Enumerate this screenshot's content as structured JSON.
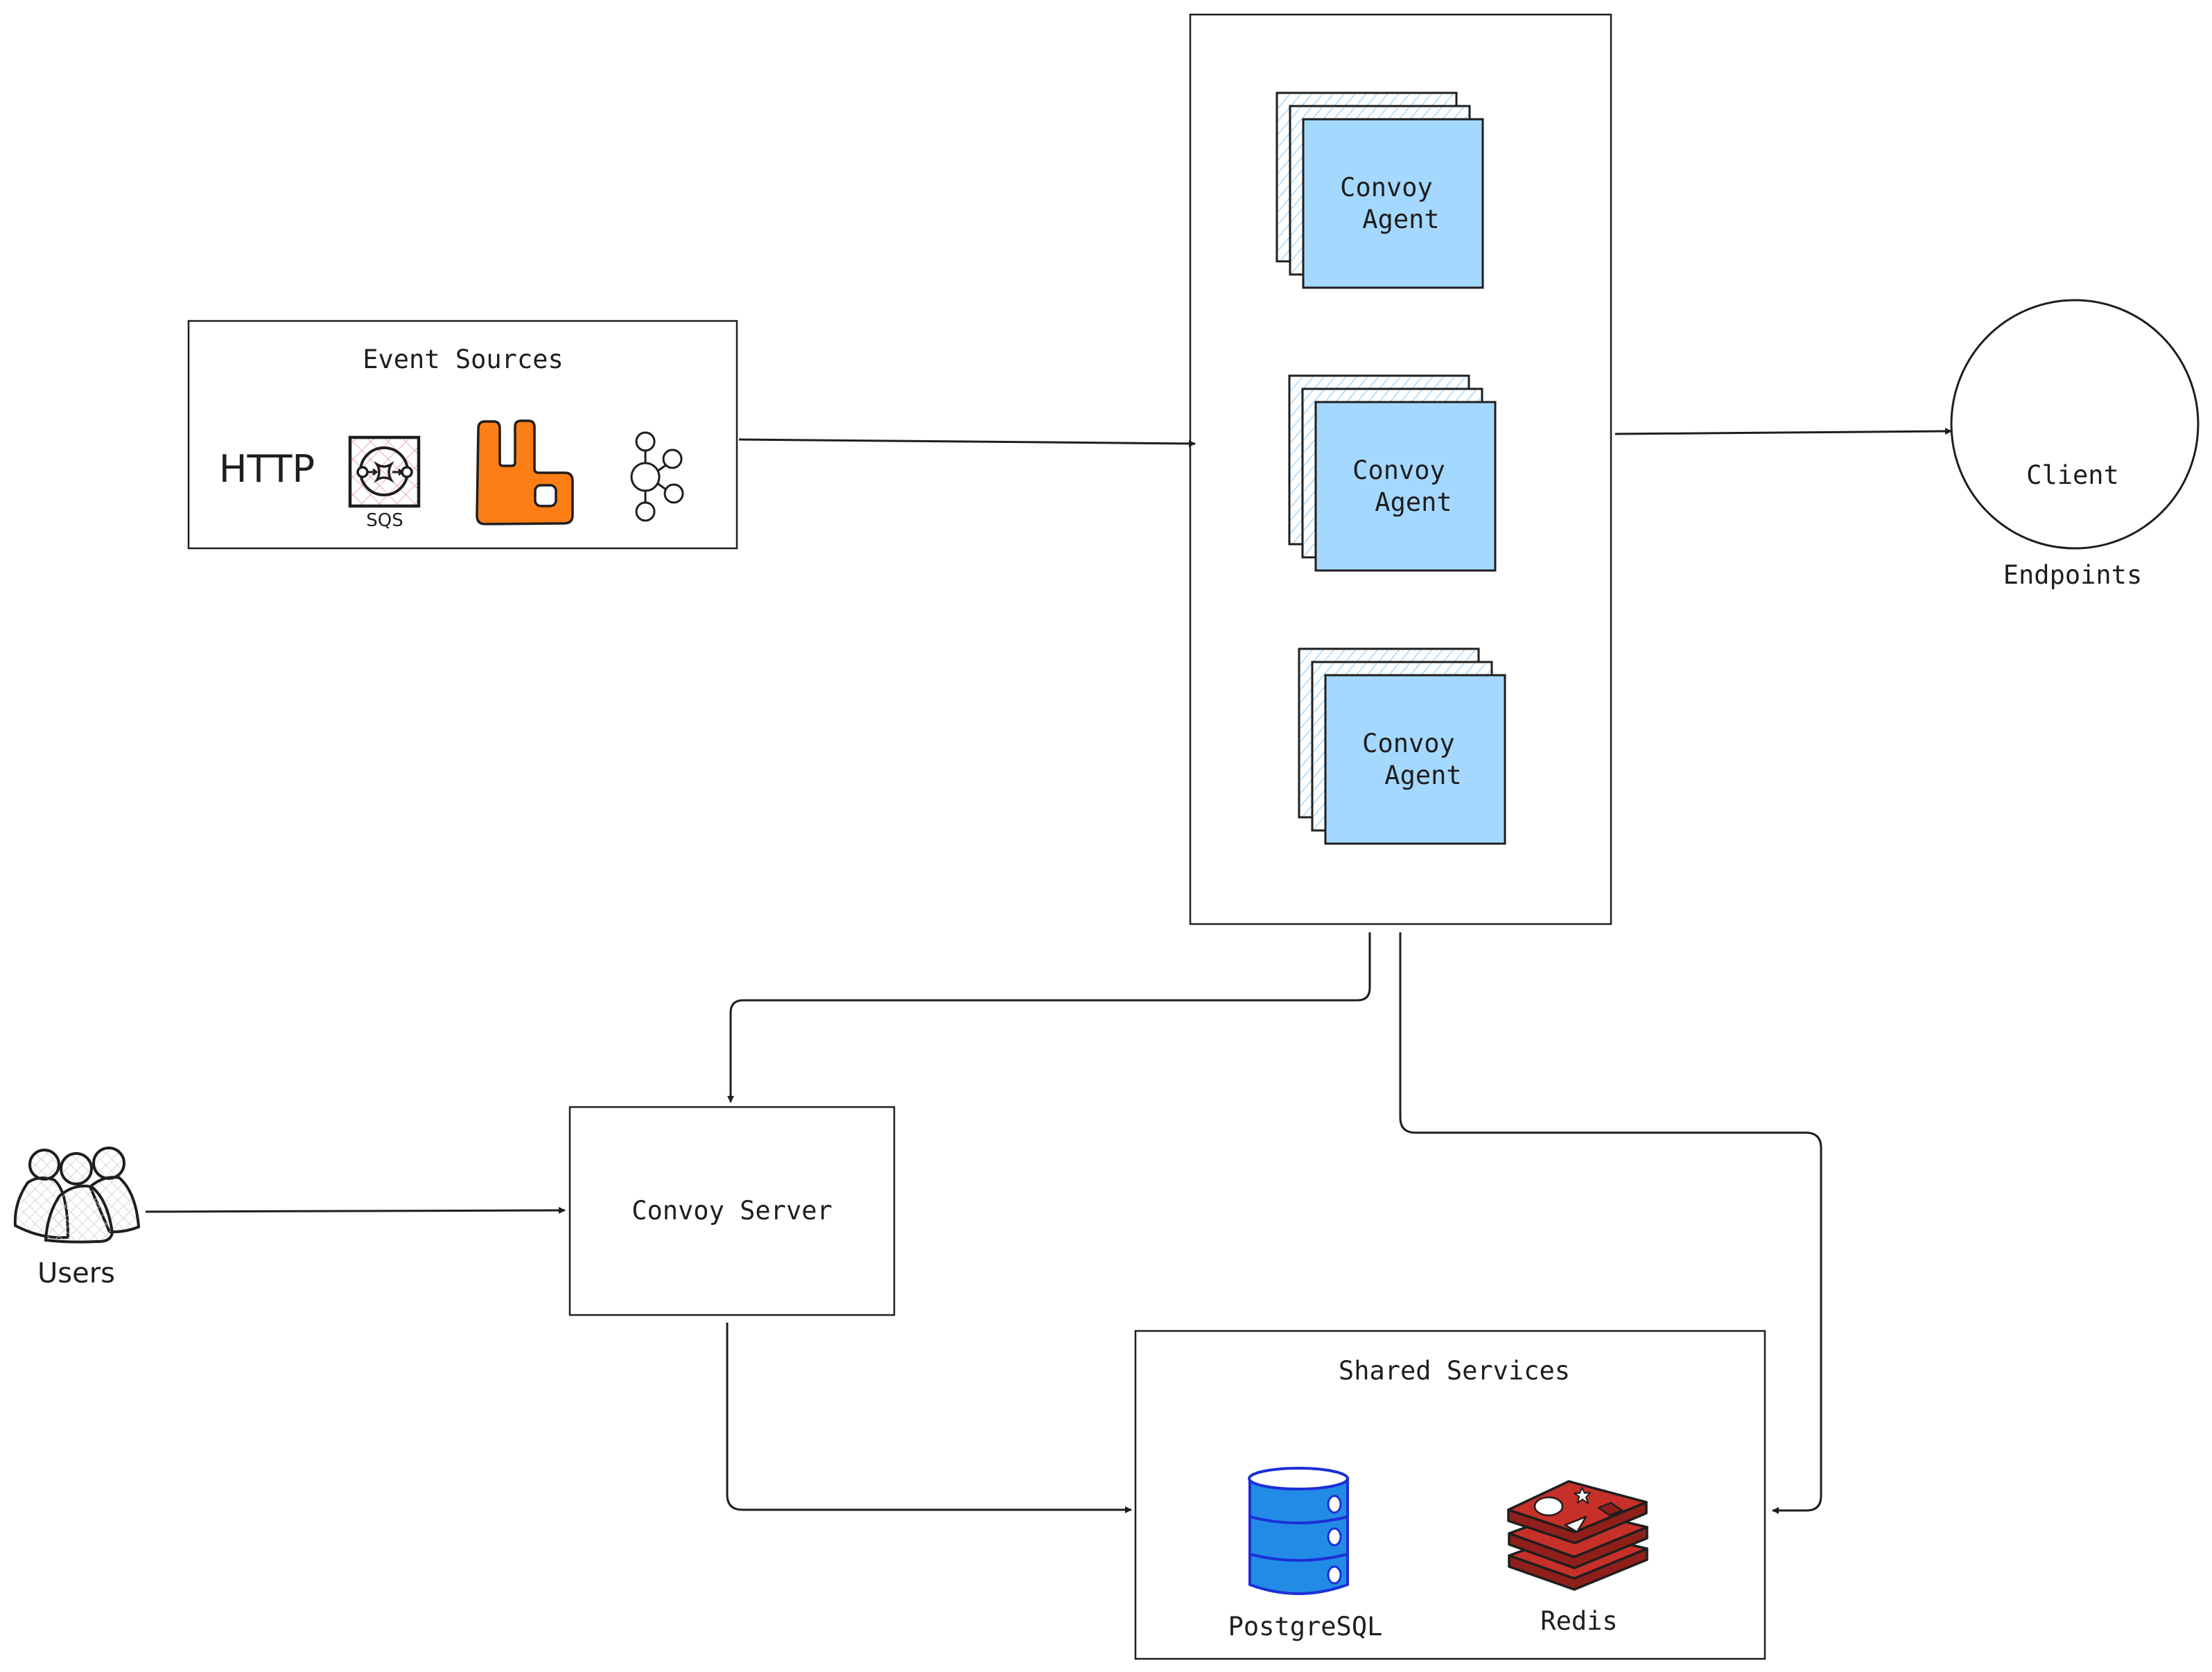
{
  "diagram": {
    "event_sources": {
      "title": "Event Sources",
      "items": [
        {
          "label": "HTTP",
          "icon": "http-text"
        },
        {
          "label": "SQS",
          "icon": "aws-sqs-icon"
        },
        {
          "label": "",
          "icon": "rabbitmq-icon"
        },
        {
          "label": "",
          "icon": "kafka-icon"
        }
      ]
    },
    "agents": [
      {
        "line1": "Convoy",
        "line2": "Agent"
      },
      {
        "line1": "Convoy",
        "line2": "Agent"
      },
      {
        "line1": "Convoy",
        "line2": "Agent"
      }
    ],
    "client_endpoints": {
      "line1": "Client",
      "line2": "Endpoints"
    },
    "users": {
      "label": "Users",
      "icon": "users-icon"
    },
    "convoy_server": {
      "label": "Convoy Server"
    },
    "shared_services": {
      "title": "Shared Services",
      "items": [
        {
          "label": "PostgreSQL",
          "icon": "database-icon"
        },
        {
          "label": "Redis",
          "icon": "redis-icon"
        }
      ]
    },
    "colors": {
      "agent_fill": "#a5d8ff",
      "agent_hatch": "#a5d8ff",
      "rabbitmq": "#fd7e14",
      "postgres_fill": "#228be6",
      "postgres_stroke": "#1c2fd6",
      "redis_fill": "#c63029",
      "redis_dark": "#8f1f1a",
      "sqs_hatch": "#eea4c4",
      "users_hatch": "#c8ced6",
      "stroke": "#1e1e1e"
    },
    "connections": [
      {
        "from": "event-sources",
        "to": "agents-container"
      },
      {
        "from": "agents-container",
        "to": "client-endpoints"
      },
      {
        "from": "agents-container",
        "to": "convoy-server"
      },
      {
        "from": "agents-container",
        "to": "shared-services"
      },
      {
        "from": "users",
        "to": "convoy-server"
      },
      {
        "from": "convoy-server",
        "to": "shared-services"
      }
    ]
  }
}
